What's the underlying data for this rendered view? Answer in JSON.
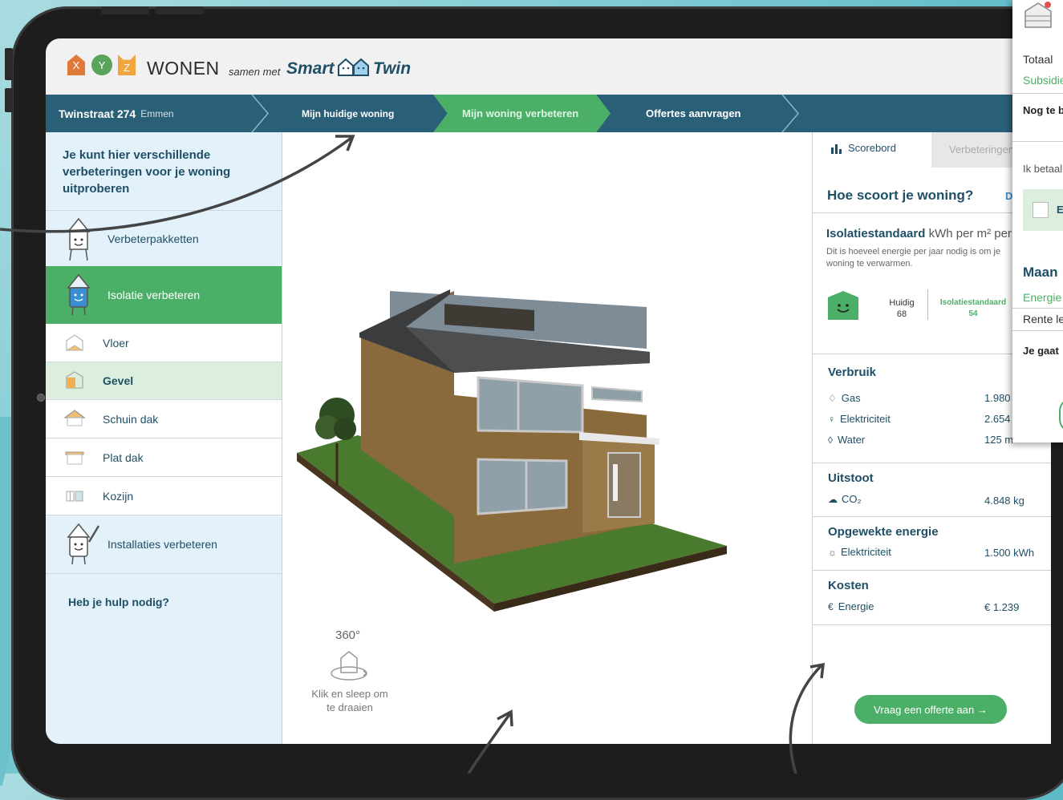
{
  "colors": {
    "accent_green": "#4caf68",
    "nav_blue": "#2a5f78",
    "text_blue": "#1f4f66",
    "sidebar_bg": "#e2f1fa"
  },
  "header": {
    "logo_letters": [
      "X",
      "Y",
      "Z"
    ],
    "brand": "WONEN",
    "tagline": "samen met",
    "partner_part1": "Smart",
    "partner_part2": "Twin"
  },
  "nav": {
    "address": "Twinstraat 274",
    "city": "Emmen",
    "steps": [
      "Mijn huidige woning",
      "Mijn woning verbeteren",
      "Offertes aanvragen"
    ],
    "active_step": "Mijn woning verbeteren"
  },
  "sidebar": {
    "intro": "Je kunt hier verschillende verbeteringen voor je woning uitproberen",
    "sections": [
      {
        "label": "Verbeterpakketten",
        "icon": "toolkit-mascot-icon"
      },
      {
        "label": "Isolatie verbeteren",
        "icon": "insulation-mascot-icon",
        "active": true
      },
      {
        "label": "Vloer",
        "icon": "floor-icon"
      },
      {
        "label": "Gevel",
        "icon": "facade-icon",
        "selected": true
      },
      {
        "label": "Schuin dak",
        "icon": "pitched-roof-icon"
      },
      {
        "label": "Plat dak",
        "icon": "flat-roof-icon"
      },
      {
        "label": "Kozijn",
        "icon": "window-frame-icon"
      },
      {
        "label": "Installaties verbeteren",
        "icon": "installation-mascot-icon"
      }
    ],
    "help": "Heb je hulp nodig?"
  },
  "viewer": {
    "rotate_degrees": "360°",
    "rotate_hint": "Klik en sleep om te draaien"
  },
  "scoreboard": {
    "tab_active": "Scorebord",
    "tab_inactive": "Verbeteringen",
    "title": "Hoe scoort je woning?",
    "title_link": "D",
    "isolation": {
      "label_bold": "Isolatiestandaard",
      "label_unit": "kWh per m² per",
      "description": "Dit is hoeveel energie per jaar nodig is om je woning te verwarmen.",
      "current_label": "Huidig",
      "current_value": "68",
      "standard_label": "Isolatiestandaard",
      "standard_value": "54"
    },
    "verbruik": {
      "title": "Verbruik",
      "rows": [
        {
          "label": "Gas",
          "value": "1.980",
          "icon": "flame-icon"
        },
        {
          "label": "Elektriciteit",
          "value": "2.654",
          "icon": "plug-icon"
        },
        {
          "label": "Water",
          "value": "125 m",
          "icon": "droplet-icon"
        }
      ]
    },
    "uitstoot": {
      "title": "Uitstoot",
      "label": "CO₂",
      "value": "4.848 kg"
    },
    "opgewekt": {
      "title": "Opgewekte energie",
      "label": "Elektriciteit",
      "value": "1.500 kWh"
    },
    "kosten": {
      "title": "Kosten",
      "label": "Energie",
      "value": "€ 1.239"
    },
    "cta": "Vraag een offerte aan →"
  },
  "popup": {
    "totaal": "Totaal",
    "subsidie": "Subsidie",
    "nog_te": "Nog te b",
    "ik_betaal": "Ik betaal",
    "checkbox_label": "E",
    "maand_title": "Maan",
    "energie": "Energie",
    "rente": "Rente le",
    "je_gaat": "Je gaat"
  }
}
